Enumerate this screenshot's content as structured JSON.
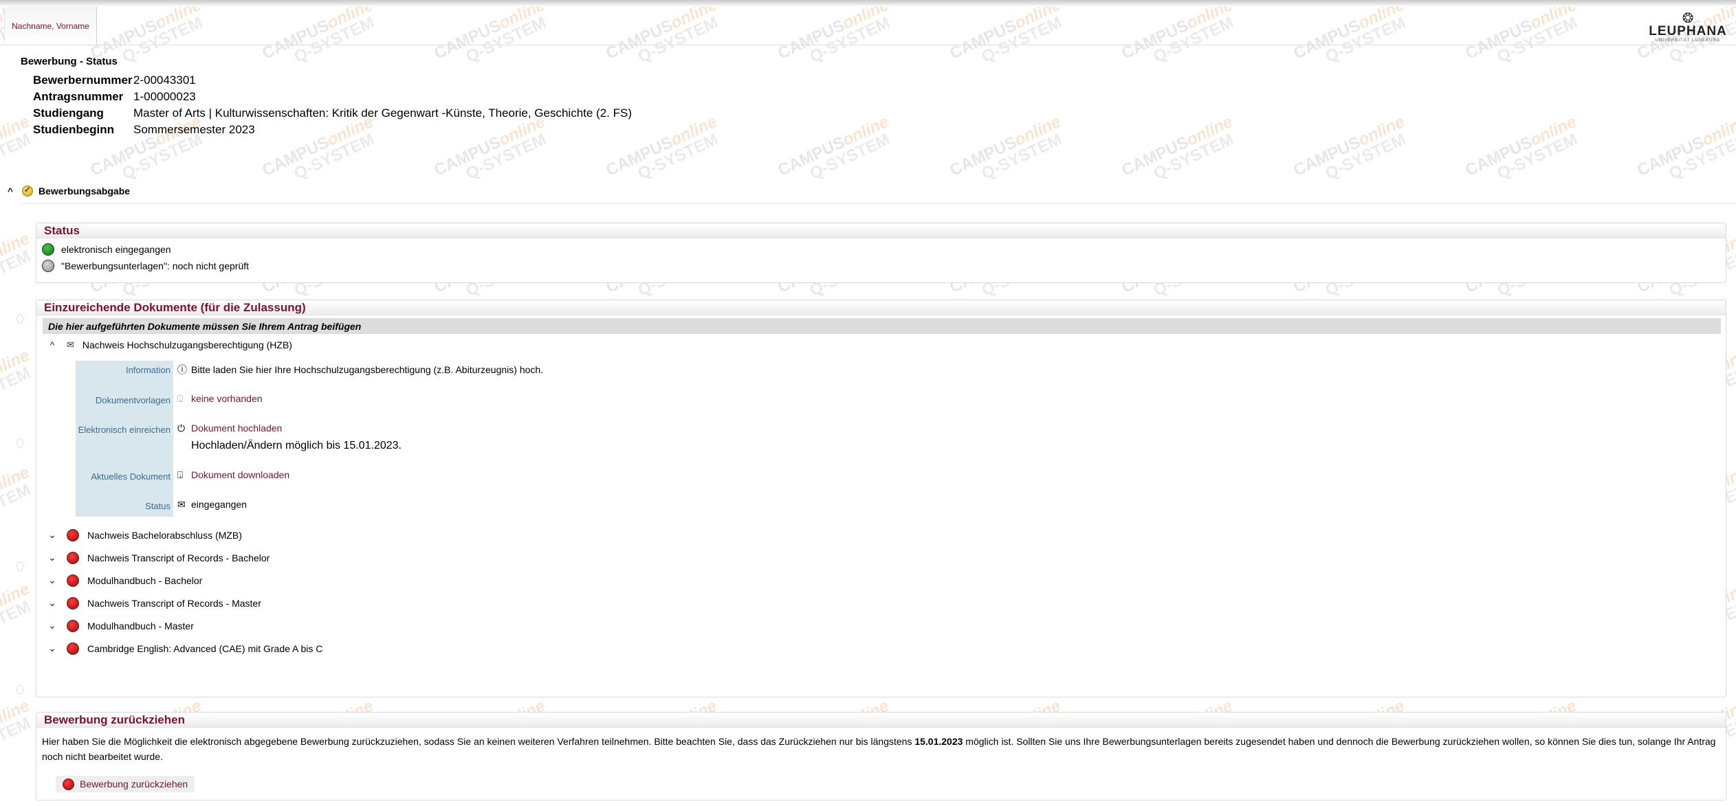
{
  "header": {
    "user_tab": "Nachname, Vorname",
    "logo_text": "LEUPHANA",
    "logo_sub": "UNIVERSITÄT LÜNEBURG"
  },
  "page": {
    "title": "Bewerbung - Status",
    "info": [
      {
        "label": "Bewerbernummer",
        "value": "2-00043301"
      },
      {
        "label": "Antragsnummer",
        "value": "1-00000023"
      },
      {
        "label": "Studiengang",
        "value": "Master of Arts | Kulturwissenschaften: Kritik der Gegenwart -Künste, Theorie, Geschichte (2. FS)"
      },
      {
        "label": "Studienbeginn",
        "value": "Sommersemester 2023"
      }
    ]
  },
  "section": {
    "toggle_label": "Bewerbungsabgabe",
    "chevron": "^"
  },
  "status_panel": {
    "title": "Status",
    "items": [
      {
        "text": "elektronisch eingegangen",
        "color": "#1a9a1a"
      },
      {
        "text": "\"Bewerbungsunterlagen\": noch nicht geprüft",
        "color": "#a0a0a0"
      }
    ]
  },
  "documents_panel": {
    "title": "Einzureichende Dokumente (für die Zulassung)",
    "subheading": "Die hier aufgeführten Dokumente müssen Sie Ihrem Antrag beifügen",
    "expanded_doc": {
      "label": "Nachweis Hochschulzugangsberechtigung (HZB)",
      "details": {
        "information_label": "Information",
        "information_text": "Bitte laden Sie hier Ihre Hochschulzugangsberechtigung (z.B. Abiturzeugnis) hoch.",
        "vorlagen_label": "Dokumentvorlagen",
        "vorlagen_link": "keine vorhanden",
        "einreichen_label": "Elektronisch einreichen",
        "einreichen_link": "Dokument hochladen",
        "einreichen_note": "Hochladen/Ändern möglich bis 15.01.2023.",
        "aktuell_label": "Aktuelles Dokument",
        "aktuell_link": "Dokument downloaden",
        "status_label": "Status",
        "status_value": "eingegangen"
      }
    },
    "collapsed_docs": [
      {
        "label": "Nachweis Bachelorabschluss (MZB)"
      },
      {
        "label": "Nachweis Transcript of Records - Bachelor"
      },
      {
        "label": "Modulhandbuch - Bachelor"
      },
      {
        "label": "Nachweis Transcript of Records - Master"
      },
      {
        "label": "Modulhandbuch - Master"
      },
      {
        "label": "Cambridge English: Advanced (CAE) mit Grade A bis C"
      }
    ]
  },
  "withdraw_panel": {
    "title": "Bewerbung zurückziehen",
    "text_before": "Hier haben Sie die Möglichkeit die elektronisch abgegebene Bewerbung zurückzuziehen, sodass Sie an keinen weiteren Verfahren teilnehmen. Bitte beachten Sie, dass das Zurückziehen nur bis längstens ",
    "deadline": "15.01.2023",
    "text_after": " möglich ist. Sollten Sie uns Ihre Bewerbungsunterlagen bereits zugesendet haben und dennoch die Bewerbung zurückziehen wollen, so können Sie dies tun, solange Ihr Antrag noch nicht bearbeitet wurde.",
    "button_label": "Bewerbung zurückziehen"
  },
  "watermark": {
    "line1_a": "CAMPUS",
    "line1_b": "online",
    "line2": "Q-SYSTEM"
  },
  "colors": {
    "accent": "#7a1330",
    "label_blue": "#3d6c8e",
    "label_bg": "#d8e6ee",
    "status_red": "#cc0000",
    "status_green": "#1a9a1a"
  }
}
